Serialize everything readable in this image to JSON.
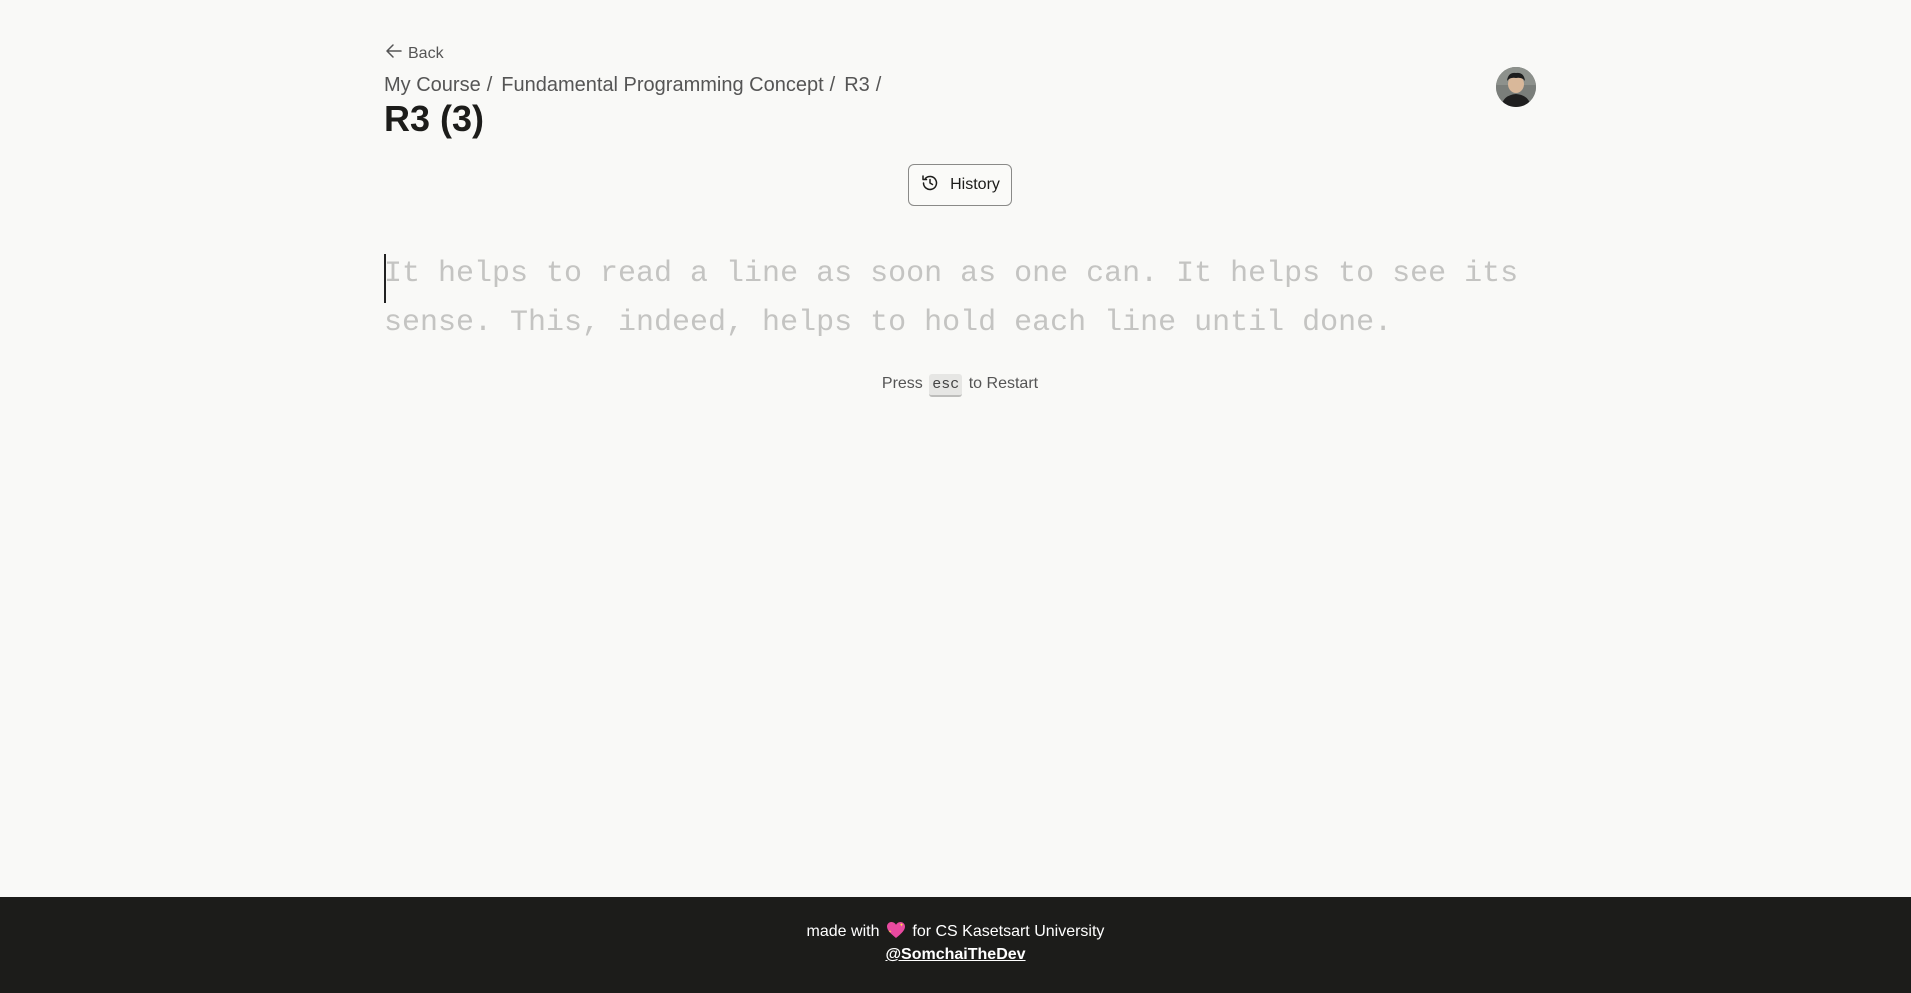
{
  "nav": {
    "back_label": "Back"
  },
  "breadcrumb": [
    {
      "label": "My Course"
    },
    {
      "label": "Fundamental Programming Concept"
    },
    {
      "label": "R3"
    }
  ],
  "breadcrumb_separator": "/",
  "page": {
    "title": "R3 (3)"
  },
  "toolbar": {
    "history_label": "History",
    "history_icon": "history-icon"
  },
  "typing": {
    "text": "It helps to read a line as soon as one can. It helps to see its sense. This, indeed, helps to hold each line until done.",
    "typed_chars": 0
  },
  "hint": {
    "prefix": "Press",
    "key": "esc",
    "suffix": "to Restart"
  },
  "footer": {
    "made_with": "made with",
    "heart_icon": "sparkling-heart-icon",
    "for_text": "for CS Kasetsart University",
    "author": "@SomchaiTheDev"
  },
  "colors": {
    "background": "#f9f9f7",
    "footer_bg": "#1c1c1a",
    "untyped_text": "#c4c4c2",
    "heart": "#e84aa0"
  }
}
